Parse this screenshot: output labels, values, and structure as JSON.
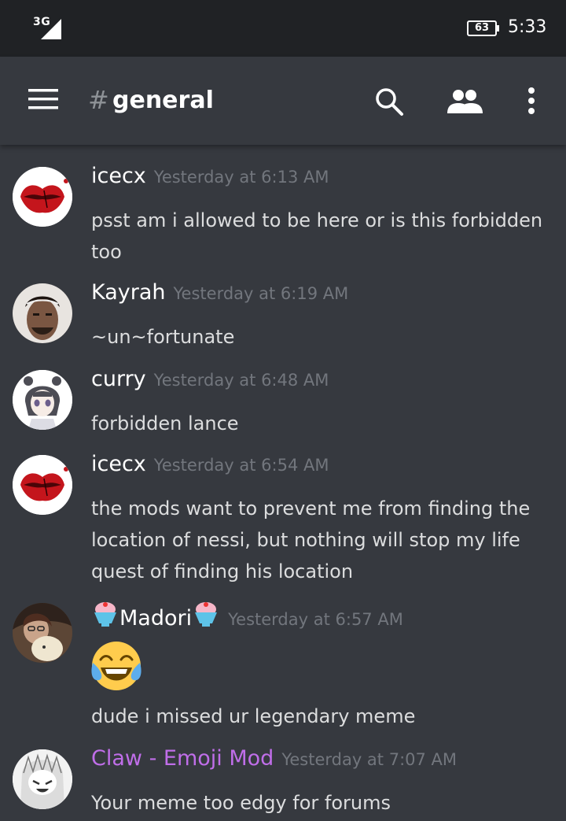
{
  "status_bar": {
    "network": "3G",
    "battery": "63",
    "time": "5:33"
  },
  "toolbar": {
    "channel_hash": "#",
    "channel_name": "general"
  },
  "messages": [
    {
      "author": "icecx",
      "timestamp": "Yesterday at 6:13 AM",
      "lines": [
        "psst am i allowed to be here or is this forbidden",
        "too"
      ]
    },
    {
      "author": "Kayrah",
      "timestamp": "Yesterday at 6:19 AM",
      "lines": [
        "~un~fortunate"
      ]
    },
    {
      "author": "curry",
      "timestamp": "Yesterday at 6:48 AM",
      "lines": [
        "forbidden lance"
      ]
    },
    {
      "author": "icecx",
      "timestamp": "Yesterday at 6:54 AM",
      "lines": [
        "the mods want to prevent me from finding the",
        "location of nessi, but nothing will stop my life",
        "quest of finding his location"
      ]
    },
    {
      "author": "Madori",
      "timestamp": "Yesterday at 6:57 AM",
      "emoji": "joy-emoji",
      "lines": [
        "dude i missed ur legendary meme"
      ]
    },
    {
      "author": "Claw - Emoji Mod",
      "author_color": "#c06ee9",
      "timestamp": "Yesterday at 7:07 AM",
      "lines": [
        "Your meme too edgy for forums"
      ]
    }
  ],
  "colors": {
    "background": "#36393f",
    "status_bar": "#202225",
    "timestamp": "#72767d",
    "mod_role": "#c06ee9"
  }
}
